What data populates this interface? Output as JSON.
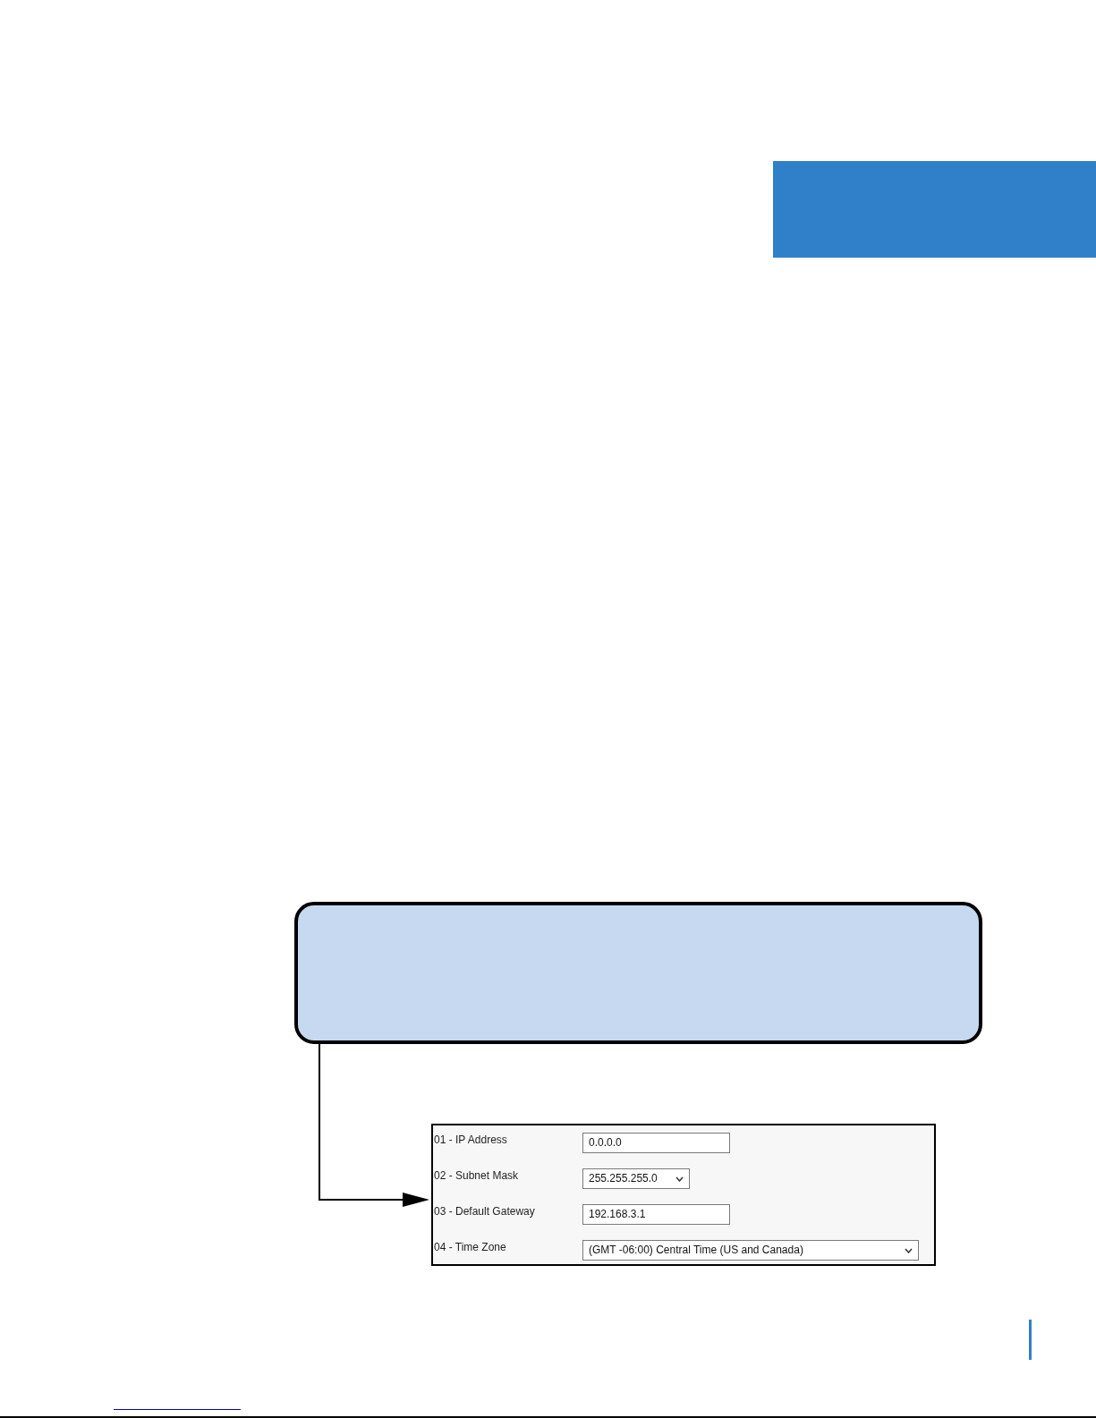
{
  "form": {
    "fields": [
      {
        "kind": "text",
        "label": "01 - IP Address",
        "value": "0.0.0.0"
      },
      {
        "kind": "select",
        "label": "02 - Subnet Mask",
        "value": "255.255.255.0"
      },
      {
        "kind": "text",
        "label": "03 - Default Gateway",
        "value": "192.168.3.1"
      },
      {
        "kind": "select",
        "label": "04 - Time Zone",
        "value": "(GMT -06:00) Central Time (US and Canada)"
      }
    ]
  }
}
